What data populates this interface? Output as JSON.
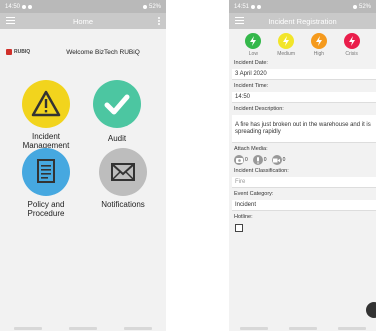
{
  "home": {
    "status": {
      "time": "14:50",
      "battery": "52%"
    },
    "title": "Home",
    "logo_text": "RUBIQ",
    "welcome": "Welcome BizTech RUBiQ",
    "tiles": [
      {
        "label": "Incident Management",
        "icon": "warning-icon",
        "color": "#f2d41d"
      },
      {
        "label": "Audit",
        "icon": "check-icon",
        "color": "#4cc6a1"
      },
      {
        "label": "Policy and Procedure",
        "icon": "document-icon",
        "color": "#46a8e0"
      },
      {
        "label": "Notifications",
        "icon": "mail-icon",
        "color": "#bdbdbd"
      }
    ]
  },
  "incident": {
    "status": {
      "time": "14:51",
      "battery": "52%"
    },
    "title": "Incident Registration",
    "severity": [
      {
        "label": "Low",
        "color": "#34b84b",
        "icon": "lightning-icon"
      },
      {
        "label": "Medium",
        "color": "#f2e52a",
        "icon": "lightning-icon"
      },
      {
        "label": "High",
        "color": "#f59a1d",
        "icon": "lightning-icon"
      },
      {
        "label": "Crisis",
        "color": "#ea1e4b",
        "icon": "lightning-icon"
      }
    ],
    "fields": {
      "date_label": "Incident Date:",
      "date_value": "3 April 2020",
      "time_label": "Incident Time:",
      "time_value": "14:50",
      "desc_label": "Incident Description:",
      "desc_value": "A fire has just broken out in the warehouse and it is spreading rapidly",
      "media_label": "Attach Media:",
      "media_counts": [
        "0",
        "0",
        "0"
      ],
      "class_label": "Incident Classification:",
      "class_value": "Fire",
      "category_label": "Event Category:",
      "category_value": "Incident",
      "hotline_label": "Hotline:"
    }
  }
}
